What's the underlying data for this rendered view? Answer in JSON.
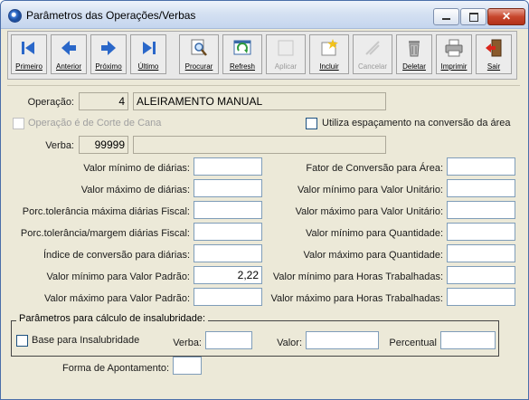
{
  "window": {
    "title": "Parâmetros das Operações/Verbas",
    "controls": {
      "close_glyph": "✕"
    }
  },
  "toolbar": {
    "primeiro": "Primeiro",
    "anterior": "Anterior",
    "proximo": "Próximo",
    "ultimo": "Último",
    "procurar": "Procurar",
    "refresh": "Refresh",
    "aplicar": "Aplicar",
    "incluir": "Incluir",
    "cancelar": "Cancelar",
    "deletar": "Deletar",
    "imprimir": "Imprimir",
    "sair": "Sair"
  },
  "operacao": {
    "label": "Operação:",
    "code": "4",
    "name": "ALEIRAMENTO MANUAL"
  },
  "checks": {
    "corte_cana": "Operação é de Corte de Cana",
    "espacamento": "Utiliza espaçamento na conversão da área"
  },
  "verba": {
    "label": "Verba:",
    "code": "99999",
    "name": ""
  },
  "left_fields": [
    {
      "label": "Valor mínimo de diárias:",
      "value": ""
    },
    {
      "label": "Valor máximo de diárias:",
      "value": ""
    },
    {
      "label": "Porc.tolerância máxima diárias Fiscal:",
      "value": ""
    },
    {
      "label": "Porc.tolerância/margem diárias Fiscal:",
      "value": ""
    },
    {
      "label": "Índice de conversão para diárias:",
      "value": ""
    },
    {
      "label": "Valor mínimo para Valor Padrão:",
      "value": "2,22"
    },
    {
      "label": "Valor máximo para Valor Padrão:",
      "value": ""
    }
  ],
  "right_fields": [
    {
      "label": "Fator de Conversão para Área:",
      "value": ""
    },
    {
      "label": "Valor mínimo para Valor Unitário:",
      "value": ""
    },
    {
      "label": "Valor máximo para Valor Unitário:",
      "value": ""
    },
    {
      "label": "Valor mínimo para Quantidade:",
      "value": ""
    },
    {
      "label": "Valor máximo para Quantidade:",
      "value": ""
    },
    {
      "label": "Valor mínimo para Horas Trabalhadas:",
      "value": ""
    },
    {
      "label": "Valor máximo para Horas Trabalhadas:",
      "value": ""
    }
  ],
  "insalubridade": {
    "title": "Parâmetros para cálculo de insalubridade:",
    "base_label": "Base para Insalubridade",
    "verba_label": "Verba:",
    "verba_value": "",
    "valor_label": "Valor:",
    "valor_value": "",
    "percentual_label": "Percentual",
    "percentual_value": ""
  },
  "apontamento": {
    "label": "Forma de Apontamento:",
    "value": ""
  },
  "colors": {
    "titlebar": "#d5e1f2",
    "window_bg": "#ece9d8",
    "field_border": "#7f9db9",
    "close_red": "#c7462d"
  },
  "icons": [
    "app-icon",
    "first-arrow-icon",
    "prev-arrow-icon",
    "next-arrow-icon",
    "last-arrow-icon",
    "search-icon",
    "refresh-icon",
    "apply-icon",
    "add-icon",
    "cancel-icon",
    "trash-icon",
    "printer-icon",
    "exit-door-icon"
  ]
}
